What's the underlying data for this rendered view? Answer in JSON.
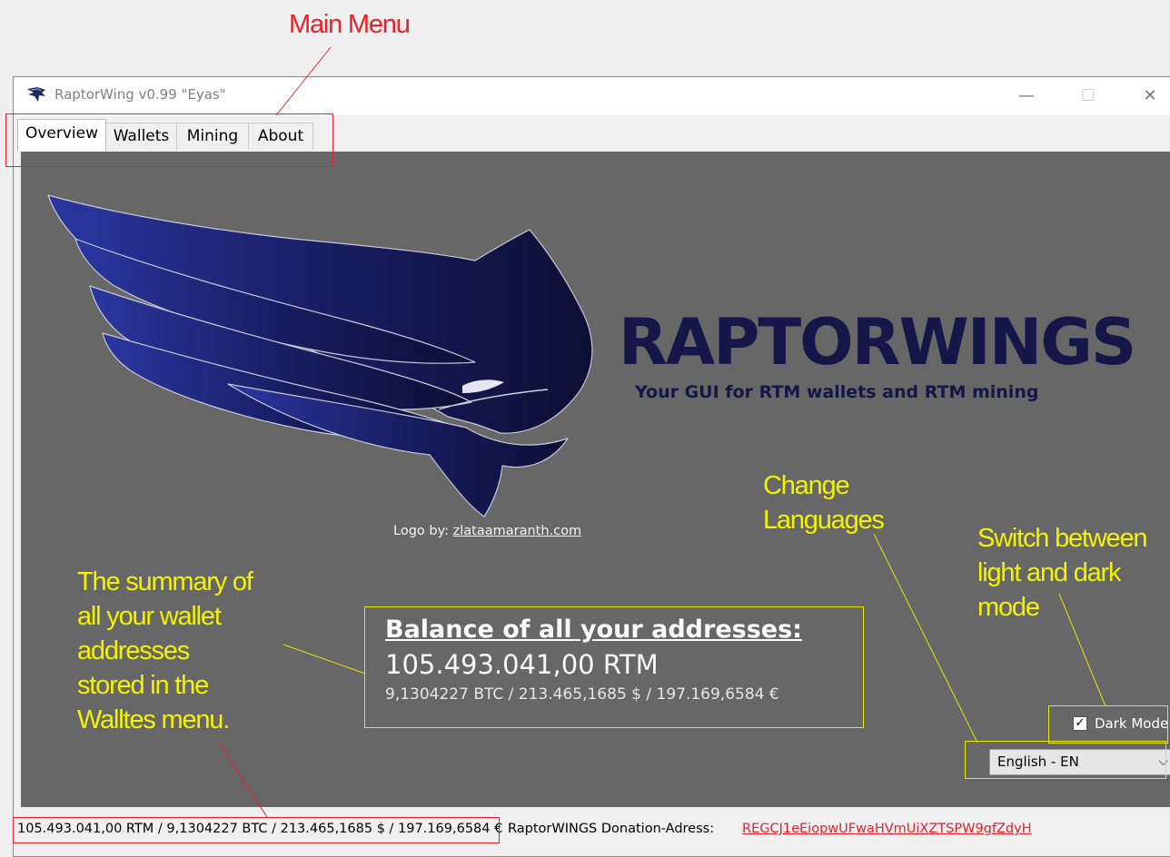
{
  "annotations": {
    "main_menu": "Main Menu",
    "change_languages": "Change\nLanguages",
    "switch_mode": "Switch between\nlight and dark\nmode",
    "summary": "The summary of\nall your wallet\naddresses\nstored in the\nWalltes menu."
  },
  "window": {
    "title": "RaptorWing v0.99 \"Eyas\"",
    "minimize_glyph": "—",
    "maximize_glyph": "☐",
    "close_glyph": "✕"
  },
  "tabs": [
    {
      "label": "Overview",
      "active": true
    },
    {
      "label": "Wallets",
      "active": false
    },
    {
      "label": "Mining",
      "active": false
    },
    {
      "label": "About",
      "active": false
    }
  ],
  "logo": {
    "brand": "RAPTORWINGS",
    "tagline": "Your GUI for RTM wallets and RTM mining",
    "credit_label": "Logo by:",
    "credit_link": "zlataamaranth.com"
  },
  "balance": {
    "heading": "Balance of all your addresses:",
    "rtm": "105.493.041,00 RTM",
    "fiat": "9,1304227 BTC / 213.465,1685 $ / 197.169,6584 €"
  },
  "settings": {
    "dark_mode_label": "Dark Mode",
    "dark_mode_checked": true,
    "language_selected": "English - EN"
  },
  "statusbar": {
    "balance": "105.493.041,00 RTM / 9,1304227 BTC / 213.465,1685 $ / 197.169,6584 €",
    "donation_label": "RaptorWINGS Donation-Adress:",
    "donation_address": "REGCJ1eEiopwUFwaHVmUiXZTSPW9gfZdyH"
  },
  "colors": {
    "annotation_red": "#e8202a",
    "annotation_yellow": "#f3f300",
    "content_bg": "#676767",
    "logo_navy": "#151749"
  }
}
